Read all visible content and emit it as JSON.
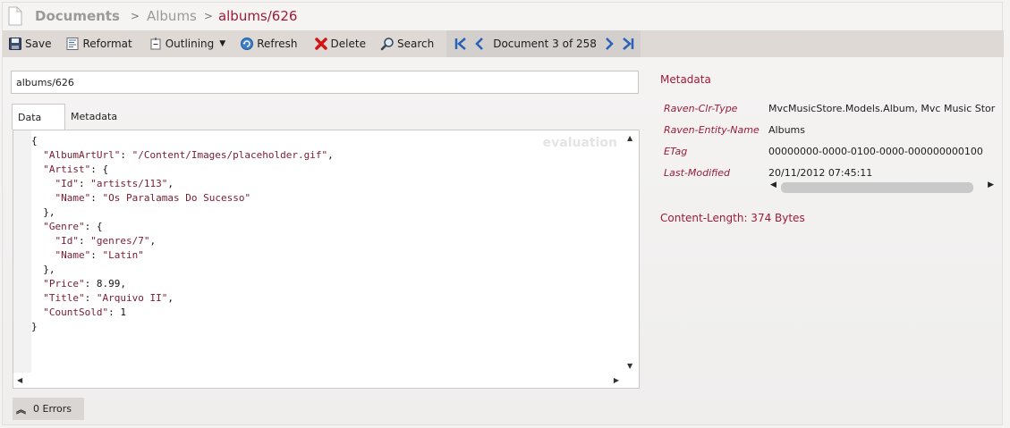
{
  "breadcrumb": {
    "root": "Documents",
    "separator": ">",
    "middle": "Albums",
    "current": "albums/626"
  },
  "toolbar": {
    "save": "Save",
    "reformat": "Reformat",
    "outlining": "Outlining",
    "refresh": "Refresh",
    "delete": "Delete",
    "search": "Search",
    "document_position": "Document 3 of 258"
  },
  "document": {
    "id_value": "albums/626",
    "tabs": [
      "Data",
      "Metadata"
    ],
    "watermark": "evaluation",
    "code_lines": [
      "{",
      "  \"AlbumArtUrl\": \"/Content/Images/placeholder.gif\",",
      "  \"Artist\": {",
      "    \"Id\": \"artists/113\",",
      "    \"Name\": \"Os Paralamas Do Sucesso\"",
      "  },",
      "  \"Genre\": {",
      "    \"Id\": \"genres/7\",",
      "    \"Name\": \"Latin\"",
      "  },",
      "  \"Price\": 8.99,",
      "  \"Title\": \"Arquivo II\",",
      "  \"CountSold\": 1",
      "}"
    ]
  },
  "errors": {
    "label": "0 Errors"
  },
  "metadata": {
    "title": "Metadata",
    "rows": [
      {
        "key": "Raven-Clr-Type",
        "value": "MvcMusicStore.Models.Album, Mvc Music Stor"
      },
      {
        "key": "Raven-Entity-Name",
        "value": "Albums"
      },
      {
        "key": "ETag",
        "value": "00000000-0000-0100-0000-000000000100"
      },
      {
        "key": "Last-Modified",
        "value": "20/11/2012 07:45:11"
      }
    ],
    "content_length": "Content-Length: 374 Bytes"
  },
  "colors": {
    "accent": "#9b1b3a",
    "toolbar": "#ded9d5",
    "nav_blue": "#2a62b8"
  }
}
